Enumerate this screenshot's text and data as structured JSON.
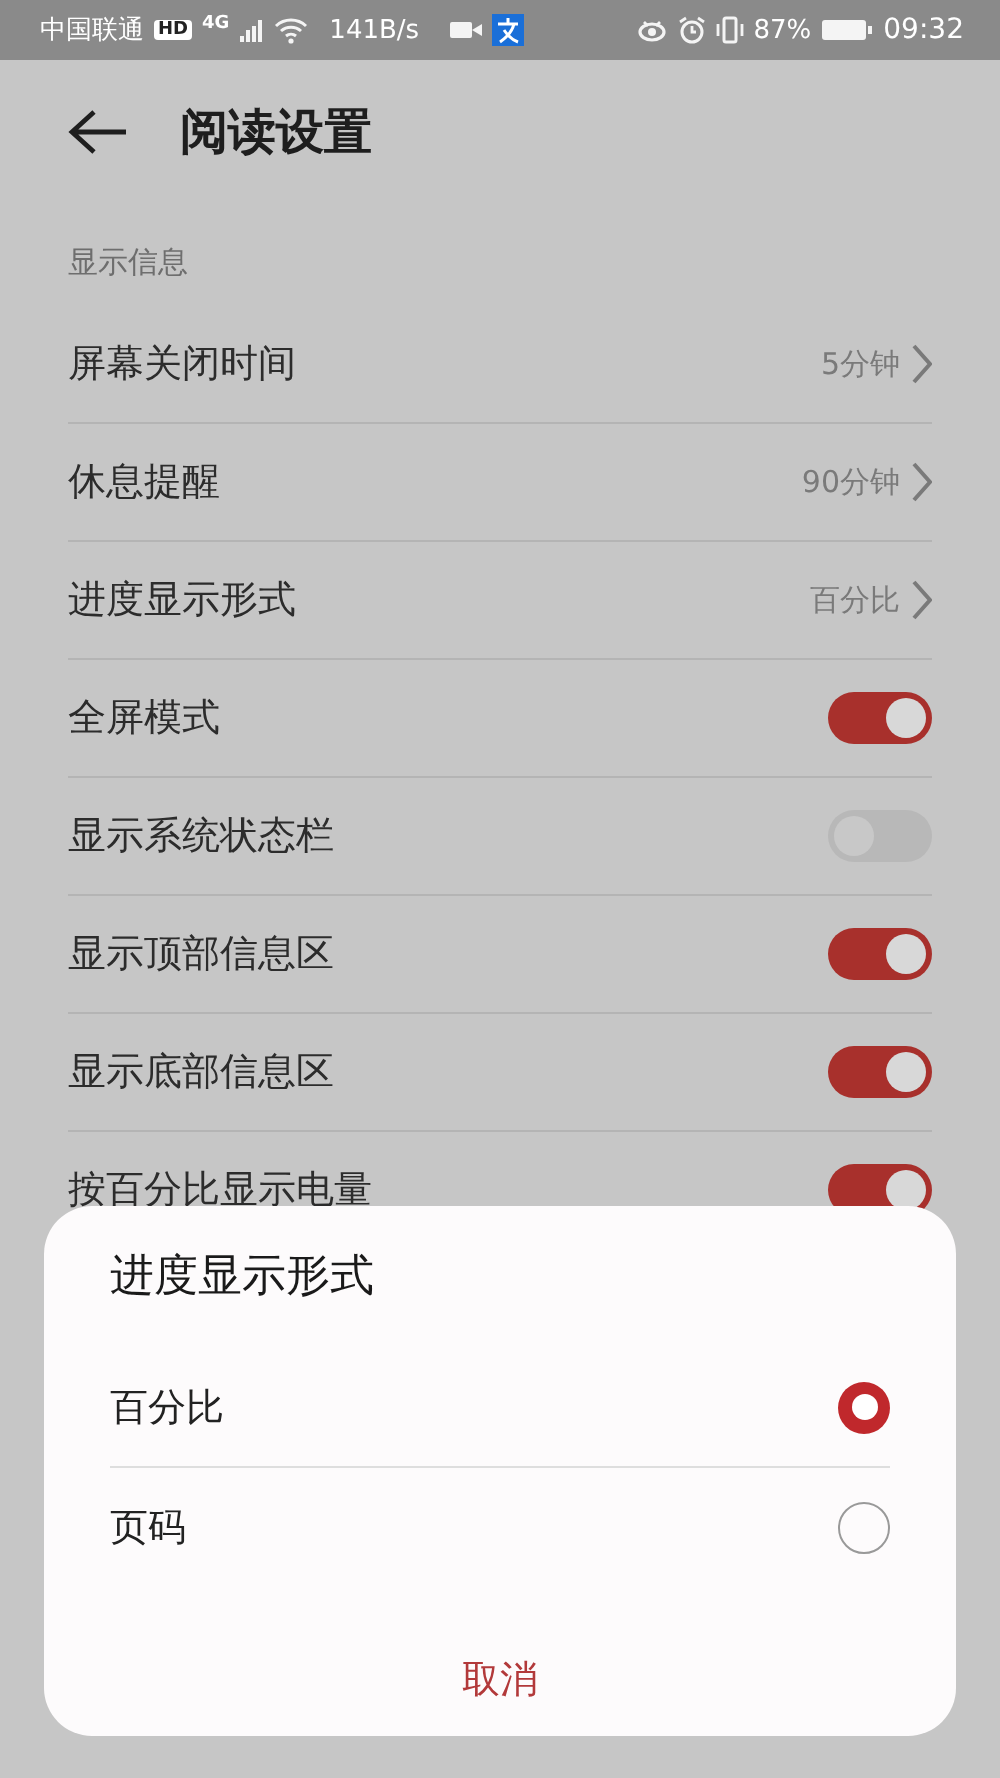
{
  "status_bar": {
    "carrier": "中国联通",
    "hd_badge": "HD",
    "network": "4G",
    "speed": "141B/s",
    "battery": "87%",
    "time": "09:32"
  },
  "header": {
    "title": "阅读设置"
  },
  "section": {
    "title": "显示信息"
  },
  "rows": [
    {
      "kind": "value",
      "label": "屏幕关闭时间",
      "value": "5分钟"
    },
    {
      "kind": "value",
      "label": "休息提醒",
      "value": "90分钟"
    },
    {
      "kind": "value",
      "label": "进度显示形式",
      "value": "百分比"
    },
    {
      "kind": "toggle",
      "label": "全屏模式",
      "on": true
    },
    {
      "kind": "toggle",
      "label": "显示系统状态栏",
      "on": false
    },
    {
      "kind": "toggle",
      "label": "显示顶部信息区",
      "on": true
    },
    {
      "kind": "toggle",
      "label": "显示底部信息区",
      "on": true
    },
    {
      "kind": "toggle",
      "label": "按百分比显示电量",
      "on": true
    }
  ],
  "dialog": {
    "title": "进度显示形式",
    "options": [
      {
        "label": "百分比",
        "selected": true
      },
      {
        "label": "页码",
        "selected": false
      }
    ],
    "cancel": "取消"
  }
}
